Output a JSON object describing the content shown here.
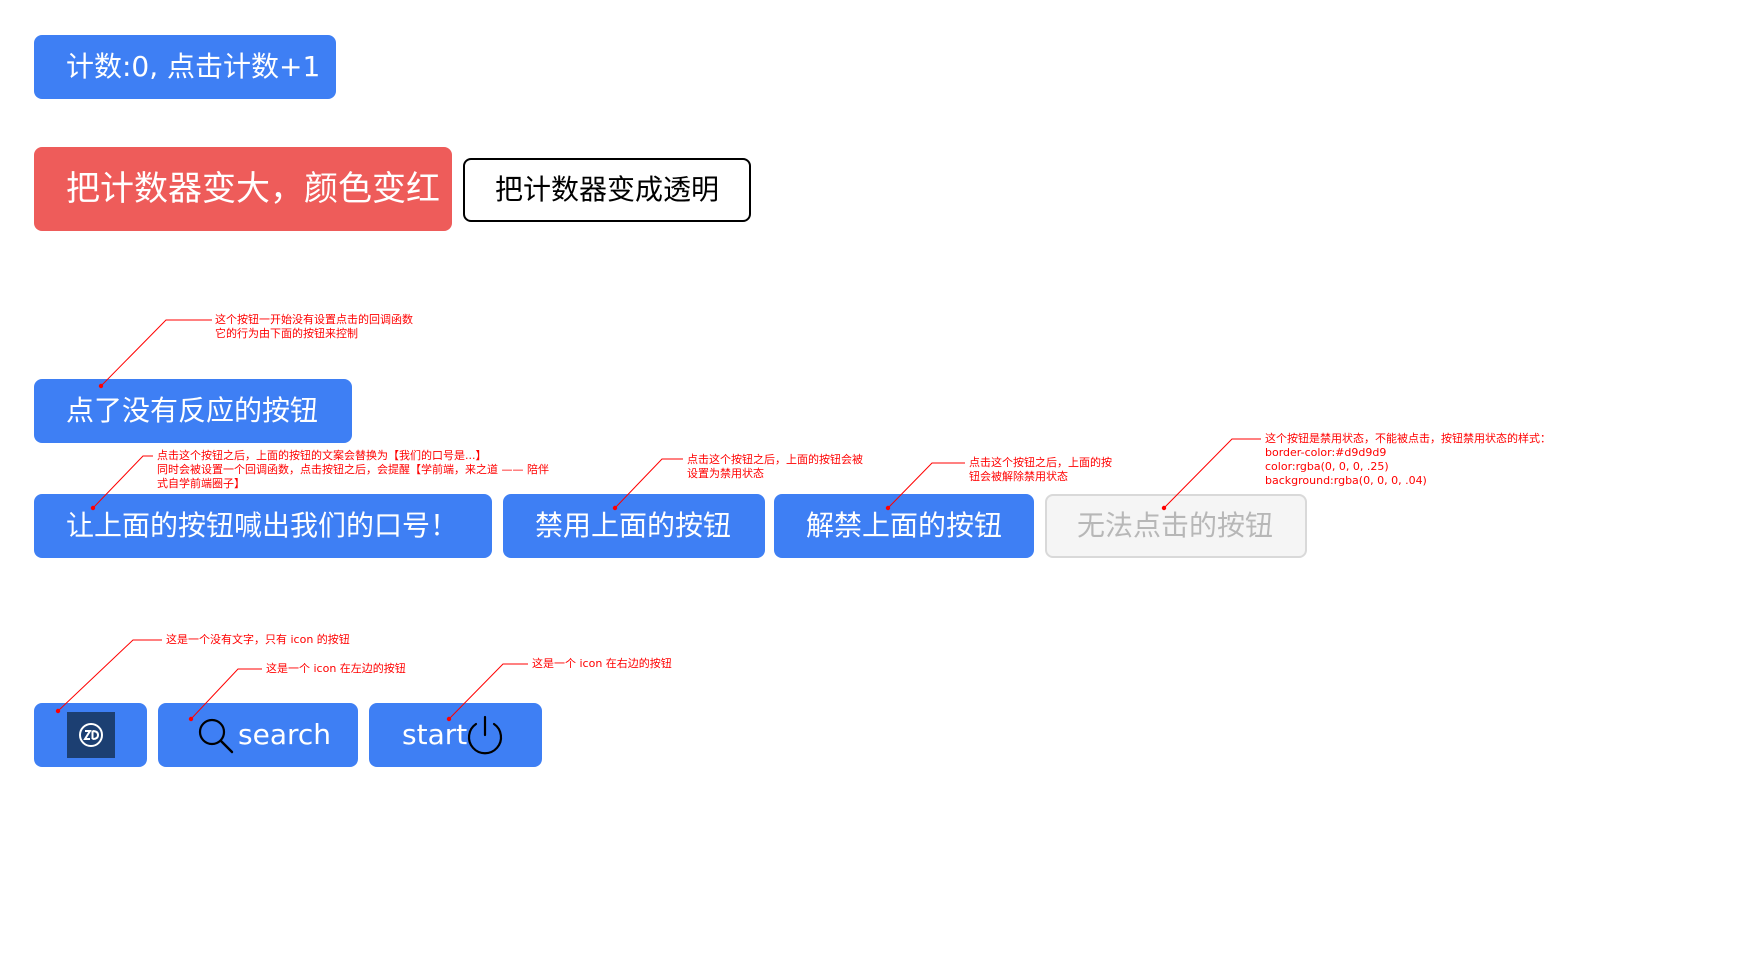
{
  "buttons": {
    "counter": "计数:0, 点击计数+1",
    "big_red": "把计数器变大，颜色变红",
    "transparent": "把计数器变成透明",
    "no_response": "点了没有反应的按钮",
    "slogan": "让上面的按钮喊出我们的口号！",
    "disable": "禁用上面的按钮",
    "enable": "解禁上面的按钮",
    "disabled": "无法点击的按钮",
    "search": "search",
    "start": "start"
  },
  "icons": {
    "icon_only": "zd-logo-icon",
    "search": "search-icon",
    "start": "power-icon"
  },
  "annotations": {
    "no_response": [
      "这个按钮一开始没有设置点击的回调函数",
      "它的行为由下面的按钮来控制"
    ],
    "slogan": [
      "点击这个按钮之后，上面的按钮的文案会替换为【我们的口号是...】",
      "同时会被设置一个回调函数，点击按钮之后，会提醒【学前端，来之道 —— 陪伴",
      "式自学前端圈子】"
    ],
    "disable": [
      "点击这个按钮之后，上面的按钮会被",
      "设置为禁用状态"
    ],
    "enable": [
      "点击这个按钮之后，上面的按",
      "钮会被解除禁用状态"
    ],
    "disabled": [
      "这个按钮是禁用状态，不能被点击，按钮禁用状态的样式：",
      "border-color:#d9d9d9",
      "color:rgba(0, 0, 0, .25)",
      "background:rgba(0, 0, 0, .04)"
    ],
    "icon_only": "这是一个没有文字，只有 icon 的按钮",
    "icon_left": "这是一个 icon 在左边的按钮",
    "icon_right": "这是一个 icon 在右边的按钮"
  },
  "colors": {
    "primary": "#3e7ff4",
    "danger": "#ee5c5a",
    "annotation": "#ff0000",
    "disabled_border": "#d9d9d9",
    "disabled_text": "rgba(0, 0, 0, .25)",
    "disabled_bg": "rgba(0, 0, 0, .04)",
    "logo_bg": "#1c3f72"
  }
}
